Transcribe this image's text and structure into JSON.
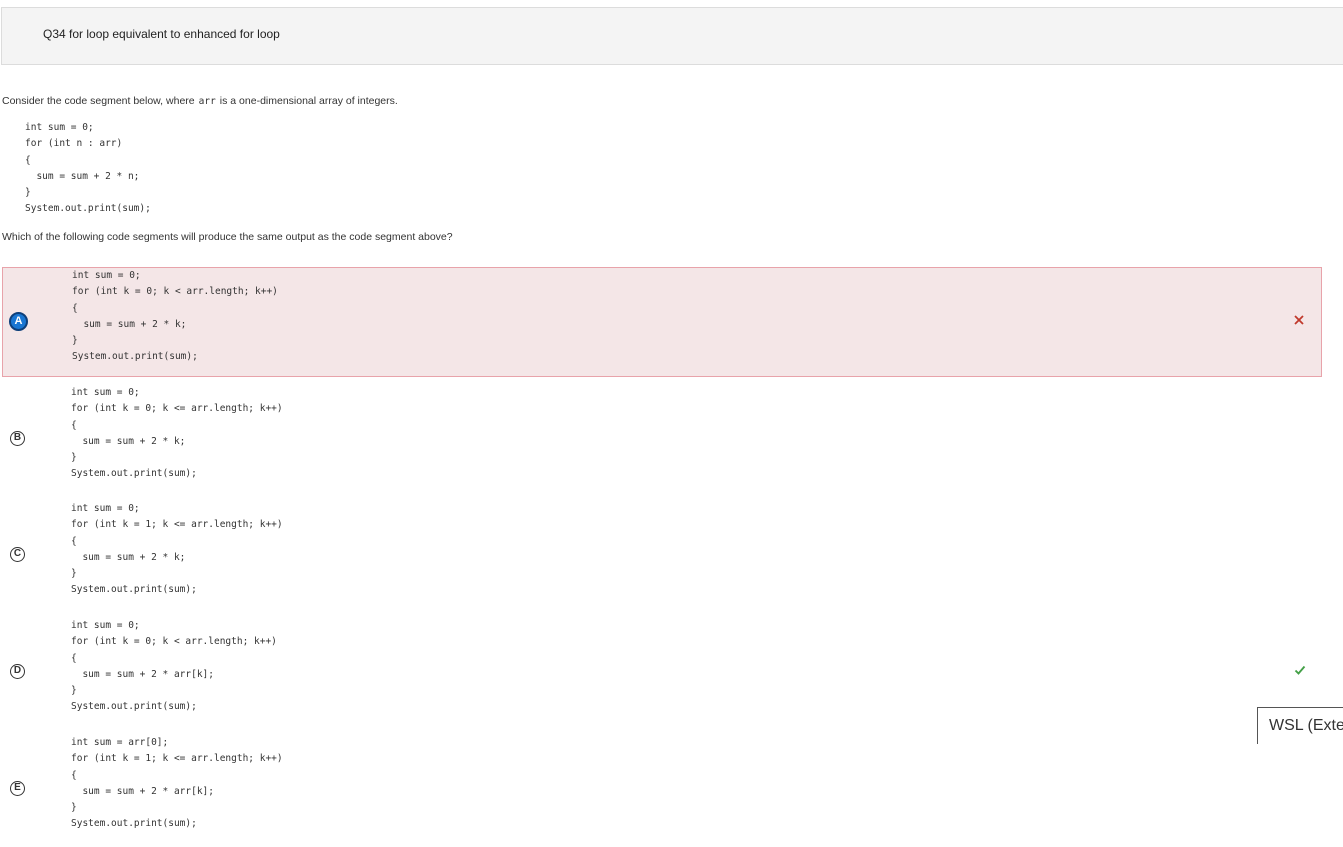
{
  "header": {
    "title": "Q34 for loop equivalent to enhanced for loop"
  },
  "question": {
    "prompt_before": "Consider the code segment below, where",
    "prompt_code": "arr",
    "prompt_after": "is a one-dimensional array of integers.",
    "stem_code": "int sum = 0;\nfor (int n : arr)\n{\n  sum = sum + 2 * n;\n}\nSystem.out.print(sum);",
    "followup": "Which of the following code segments will produce the same output as the code segment above?"
  },
  "options": [
    {
      "letter": "A",
      "code": "int sum = 0;\nfor (int k = 0; k < arr.length; k++)\n{\n  sum = sum + 2 * k;\n}\nSystem.out.print(sum);",
      "state": "selected-incorrect",
      "mark_icon": "x-icon",
      "mark_color": "#c0392b"
    },
    {
      "letter": "B",
      "code": "int sum = 0;\nfor (int k = 0; k <= arr.length; k++)\n{\n  sum = sum + 2 * k;\n}\nSystem.out.print(sum);",
      "state": "unselected"
    },
    {
      "letter": "C",
      "code": "int sum = 0;\nfor (int k = 1; k <= arr.length; k++)\n{\n  sum = sum + 2 * k;\n}\nSystem.out.print(sum);",
      "state": "unselected"
    },
    {
      "letter": "D",
      "code": "int sum = 0;\nfor (int k = 0; k < arr.length; k++)\n{\n  sum = sum + 2 * arr[k];\n}\nSystem.out.print(sum);",
      "state": "correct",
      "mark_icon": "check-icon",
      "mark_color": "#43a047"
    },
    {
      "letter": "E",
      "code": "int sum = arr[0];\nfor (int k = 1; k <= arr.length; k++)\n{\n  sum = sum + 2 * arr[k];\n}\nSystem.out.print(sum);",
      "state": "unselected"
    }
  ],
  "tooltip": {
    "text": "WSL (Exte"
  },
  "colors": {
    "accent": "#1976d2",
    "wrong_bg": "#f4e6e7",
    "wrong_border": "#e8a3aa"
  }
}
